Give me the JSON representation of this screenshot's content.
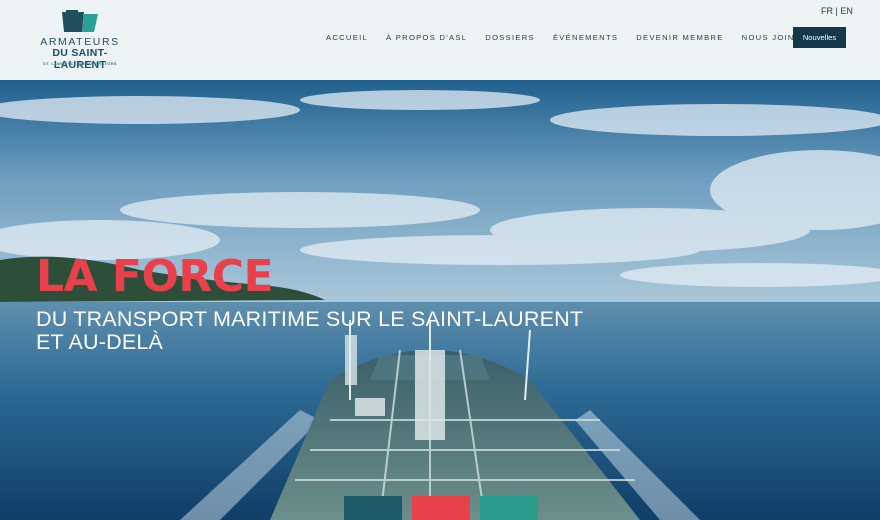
{
  "logo": {
    "line1": "ARMATEURS",
    "line2": "DU SAINT-LAURENT",
    "line3": "ST. LAWRENCE SHIPOPERATORS"
  },
  "lang": {
    "fr": "FR",
    "sep": " | ",
    "en": "EN"
  },
  "nav": {
    "items": [
      "ACCUEIL",
      "À PROPOS D'ASL",
      "DOSSIERS",
      "ÉVÉNEMENTS",
      "DEVENIR MEMBRE",
      "NOUS JOINDRE"
    ],
    "button": "Nouvelles"
  },
  "hero": {
    "title": "LA FORCE",
    "subtitle_line1": "DU TRANSPORT MARITIME SUR LE SAINT-LAURENT",
    "subtitle_line2": "ET AU-DELÀ"
  },
  "colors": {
    "brand_dark": "#14394a",
    "accent_red": "#e8414b",
    "accent_teal": "#2a9d8f",
    "header_bg": "#eef3f6"
  }
}
